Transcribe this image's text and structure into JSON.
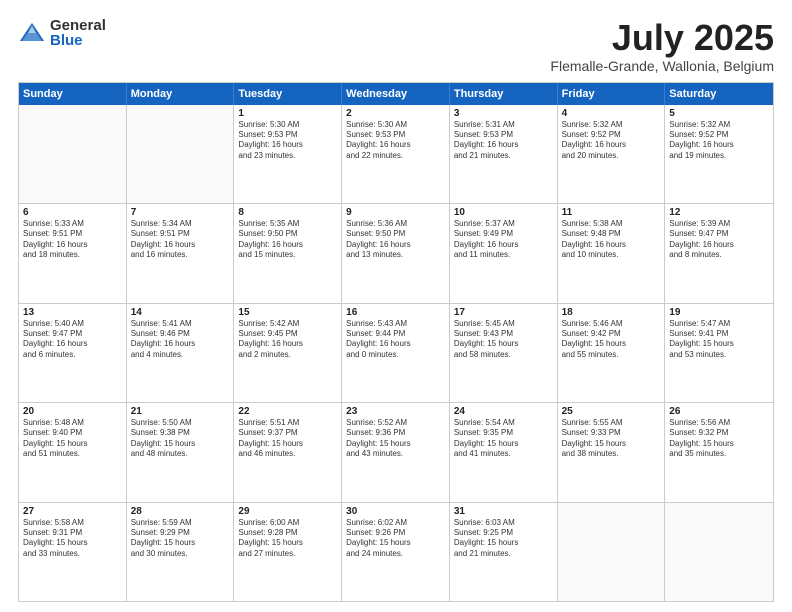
{
  "logo": {
    "general": "General",
    "blue": "Blue"
  },
  "title": "July 2025",
  "subtitle": "Flemalle-Grande, Wallonia, Belgium",
  "header_days": [
    "Sunday",
    "Monday",
    "Tuesday",
    "Wednesday",
    "Thursday",
    "Friday",
    "Saturday"
  ],
  "rows": [
    [
      {
        "day": "",
        "lines": []
      },
      {
        "day": "",
        "lines": []
      },
      {
        "day": "1",
        "lines": [
          "Sunrise: 5:30 AM",
          "Sunset: 9:53 PM",
          "Daylight: 16 hours",
          "and 23 minutes."
        ]
      },
      {
        "day": "2",
        "lines": [
          "Sunrise: 5:30 AM",
          "Sunset: 9:53 PM",
          "Daylight: 16 hours",
          "and 22 minutes."
        ]
      },
      {
        "day": "3",
        "lines": [
          "Sunrise: 5:31 AM",
          "Sunset: 9:53 PM",
          "Daylight: 16 hours",
          "and 21 minutes."
        ]
      },
      {
        "day": "4",
        "lines": [
          "Sunrise: 5:32 AM",
          "Sunset: 9:52 PM",
          "Daylight: 16 hours",
          "and 20 minutes."
        ]
      },
      {
        "day": "5",
        "lines": [
          "Sunrise: 5:32 AM",
          "Sunset: 9:52 PM",
          "Daylight: 16 hours",
          "and 19 minutes."
        ]
      }
    ],
    [
      {
        "day": "6",
        "lines": [
          "Sunrise: 5:33 AM",
          "Sunset: 9:51 PM",
          "Daylight: 16 hours",
          "and 18 minutes."
        ]
      },
      {
        "day": "7",
        "lines": [
          "Sunrise: 5:34 AM",
          "Sunset: 9:51 PM",
          "Daylight: 16 hours",
          "and 16 minutes."
        ]
      },
      {
        "day": "8",
        "lines": [
          "Sunrise: 5:35 AM",
          "Sunset: 9:50 PM",
          "Daylight: 16 hours",
          "and 15 minutes."
        ]
      },
      {
        "day": "9",
        "lines": [
          "Sunrise: 5:36 AM",
          "Sunset: 9:50 PM",
          "Daylight: 16 hours",
          "and 13 minutes."
        ]
      },
      {
        "day": "10",
        "lines": [
          "Sunrise: 5:37 AM",
          "Sunset: 9:49 PM",
          "Daylight: 16 hours",
          "and 11 minutes."
        ]
      },
      {
        "day": "11",
        "lines": [
          "Sunrise: 5:38 AM",
          "Sunset: 9:48 PM",
          "Daylight: 16 hours",
          "and 10 minutes."
        ]
      },
      {
        "day": "12",
        "lines": [
          "Sunrise: 5:39 AM",
          "Sunset: 9:47 PM",
          "Daylight: 16 hours",
          "and 8 minutes."
        ]
      }
    ],
    [
      {
        "day": "13",
        "lines": [
          "Sunrise: 5:40 AM",
          "Sunset: 9:47 PM",
          "Daylight: 16 hours",
          "and 6 minutes."
        ]
      },
      {
        "day": "14",
        "lines": [
          "Sunrise: 5:41 AM",
          "Sunset: 9:46 PM",
          "Daylight: 16 hours",
          "and 4 minutes."
        ]
      },
      {
        "day": "15",
        "lines": [
          "Sunrise: 5:42 AM",
          "Sunset: 9:45 PM",
          "Daylight: 16 hours",
          "and 2 minutes."
        ]
      },
      {
        "day": "16",
        "lines": [
          "Sunrise: 5:43 AM",
          "Sunset: 9:44 PM",
          "Daylight: 16 hours",
          "and 0 minutes."
        ]
      },
      {
        "day": "17",
        "lines": [
          "Sunrise: 5:45 AM",
          "Sunset: 9:43 PM",
          "Daylight: 15 hours",
          "and 58 minutes."
        ]
      },
      {
        "day": "18",
        "lines": [
          "Sunrise: 5:46 AM",
          "Sunset: 9:42 PM",
          "Daylight: 15 hours",
          "and 55 minutes."
        ]
      },
      {
        "day": "19",
        "lines": [
          "Sunrise: 5:47 AM",
          "Sunset: 9:41 PM",
          "Daylight: 15 hours",
          "and 53 minutes."
        ]
      }
    ],
    [
      {
        "day": "20",
        "lines": [
          "Sunrise: 5:48 AM",
          "Sunset: 9:40 PM",
          "Daylight: 15 hours",
          "and 51 minutes."
        ]
      },
      {
        "day": "21",
        "lines": [
          "Sunrise: 5:50 AM",
          "Sunset: 9:38 PM",
          "Daylight: 15 hours",
          "and 48 minutes."
        ]
      },
      {
        "day": "22",
        "lines": [
          "Sunrise: 5:51 AM",
          "Sunset: 9:37 PM",
          "Daylight: 15 hours",
          "and 46 minutes."
        ]
      },
      {
        "day": "23",
        "lines": [
          "Sunrise: 5:52 AM",
          "Sunset: 9:36 PM",
          "Daylight: 15 hours",
          "and 43 minutes."
        ]
      },
      {
        "day": "24",
        "lines": [
          "Sunrise: 5:54 AM",
          "Sunset: 9:35 PM",
          "Daylight: 15 hours",
          "and 41 minutes."
        ]
      },
      {
        "day": "25",
        "lines": [
          "Sunrise: 5:55 AM",
          "Sunset: 9:33 PM",
          "Daylight: 15 hours",
          "and 38 minutes."
        ]
      },
      {
        "day": "26",
        "lines": [
          "Sunrise: 5:56 AM",
          "Sunset: 9:32 PM",
          "Daylight: 15 hours",
          "and 35 minutes."
        ]
      }
    ],
    [
      {
        "day": "27",
        "lines": [
          "Sunrise: 5:58 AM",
          "Sunset: 9:31 PM",
          "Daylight: 15 hours",
          "and 33 minutes."
        ]
      },
      {
        "day": "28",
        "lines": [
          "Sunrise: 5:59 AM",
          "Sunset: 9:29 PM",
          "Daylight: 15 hours",
          "and 30 minutes."
        ]
      },
      {
        "day": "29",
        "lines": [
          "Sunrise: 6:00 AM",
          "Sunset: 9:28 PM",
          "Daylight: 15 hours",
          "and 27 minutes."
        ]
      },
      {
        "day": "30",
        "lines": [
          "Sunrise: 6:02 AM",
          "Sunset: 9:26 PM",
          "Daylight: 15 hours",
          "and 24 minutes."
        ]
      },
      {
        "day": "31",
        "lines": [
          "Sunrise: 6:03 AM",
          "Sunset: 9:25 PM",
          "Daylight: 15 hours",
          "and 21 minutes."
        ]
      },
      {
        "day": "",
        "lines": []
      },
      {
        "day": "",
        "lines": []
      }
    ]
  ]
}
